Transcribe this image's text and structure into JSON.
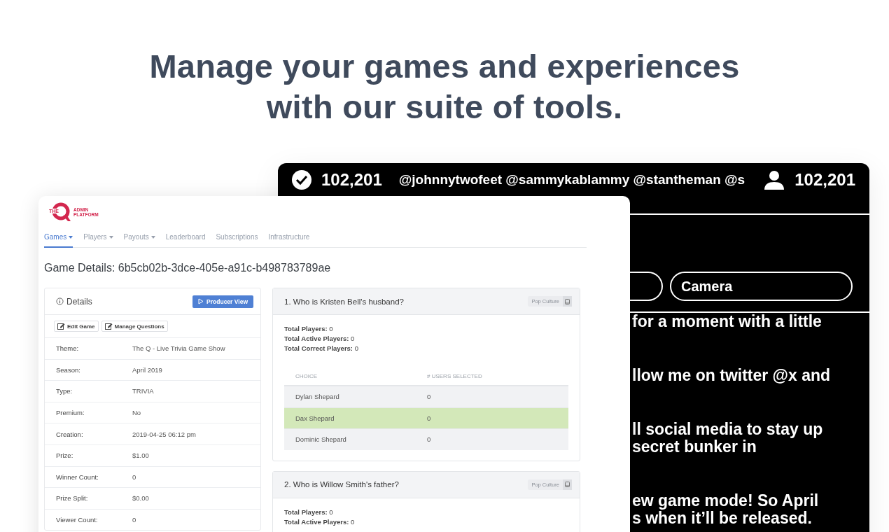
{
  "headline": {
    "lines": [
      "Manage your games and experiences",
      "with our suite of tools."
    ]
  },
  "stream_view": {
    "ticker": {
      "left_count": "102,201",
      "mentions": "@johnnytwofeet  @sammykablammy @stantheman @s",
      "right_count": "102,201"
    },
    "pills": [
      {
        "kind": "partial"
      },
      {
        "kind": "full",
        "label": "Camera"
      }
    ],
    "messages": [
      [
        "for a moment with a little"
      ],
      [
        "llow me on twitter @x and"
      ],
      [
        "ll social media to stay up",
        "secret bunker in"
      ],
      [
        "ew game mode! So April",
        "s when it’ll be released."
      ]
    ]
  },
  "admin": {
    "logo": {
      "small": "THE",
      "lines": [
        "ADMIN",
        "PLATFORM"
      ]
    },
    "nav": [
      {
        "label": "Games",
        "dropdown": true,
        "selected": true
      },
      {
        "label": "Players",
        "dropdown": true,
        "selected": false
      },
      {
        "label": "Payouts",
        "dropdown": true,
        "selected": false
      },
      {
        "label": "Leaderboard",
        "dropdown": false,
        "selected": false
      },
      {
        "label": "Subscriptions",
        "dropdown": false,
        "selected": false
      },
      {
        "label": "Infrastructure",
        "dropdown": false,
        "selected": false
      }
    ],
    "title": "Game Details: 6b5cb02b-3dce-405e-a91c-b498783789ae",
    "details": {
      "heading": "Details",
      "producer_button": "Producer View",
      "actions": [
        "Edit Game",
        "Manage Questions"
      ],
      "rows": [
        {
          "label": "Theme:",
          "value": "The Q - Live Trivia Game Show"
        },
        {
          "label": "Season:",
          "value": "April 2019"
        },
        {
          "label": "Type:",
          "value": "TRIVIA"
        },
        {
          "label": "Premium:",
          "value": "No"
        },
        {
          "label": "Creation:",
          "value": "2019-04-25 06:12 pm"
        },
        {
          "label": "Prize:",
          "value": "$1.00"
        },
        {
          "label": "Winner Count:",
          "value": "0"
        },
        {
          "label": "Prize Split:",
          "value": "$0.00"
        },
        {
          "label": "Viewer Count:",
          "value": "0"
        }
      ]
    },
    "questions": [
      {
        "title": "1. Who is Kristen Bell's husband?",
        "category": "Pop Culture",
        "stats": [
          "**Total Players:** 0",
          "**Total Active Players:** 0",
          "**Total Correct Players:** 0"
        ],
        "columns": [
          "CHOICE",
          "# USERS SELECTED"
        ],
        "choices": [
          {
            "choice": "Dylan Shepard",
            "count": "0",
            "correct": false
          },
          {
            "choice": "Dax Shepard",
            "count": "0",
            "correct": true
          },
          {
            "choice": "Dominic Shepard",
            "count": "0",
            "correct": false
          }
        ]
      },
      {
        "title": "2. Who is Willow Smith's father?",
        "category": "Pop Culture",
        "stats": [
          "**Total Players:** 0",
          "**Total Active Players:** 0"
        ]
      }
    ]
  }
}
